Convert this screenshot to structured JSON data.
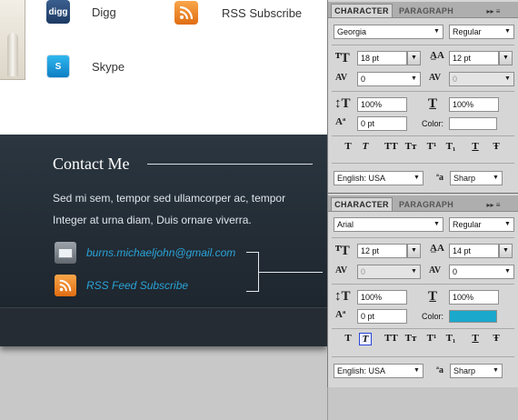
{
  "social": {
    "digg": {
      "icon": "digg-icon",
      "label": "Digg"
    },
    "rss": {
      "icon": "rss-icon",
      "label": "RSS Subscribe"
    },
    "skype": {
      "icon": "skype-icon",
      "label": "Skype"
    }
  },
  "footer": {
    "title": "Contact Me",
    "line1": "Sed mi sem, tempor sed ullamcorper ac, tempor",
    "line2": "Integer at urna diam, Duis ornare viverra.",
    "email": "burns.michaeljohn@gmail.com",
    "rss_link": "RSS Feed Subscribe"
  },
  "panel1": {
    "tabs": [
      "CHARACTER",
      "PARAGRAPH"
    ],
    "menu": "▸▸ ≡",
    "font_family": "Georgia",
    "font_style": "Regular",
    "font_size": "18 pt",
    "leading": "12 pt",
    "kerning": "0",
    "tracking": "0",
    "vscale": "100%",
    "hscale": "100%",
    "baseline": "0 pt",
    "color_label": "Color:",
    "color": "#ffffff",
    "language": "English: USA",
    "aa_label": "ªa",
    "antialias": "Sharp"
  },
  "panel2": {
    "tabs": [
      "CHARACTER",
      "PARAGRAPH"
    ],
    "menu": "▸▸ ≡",
    "font_family": "Arial",
    "font_style": "Regular",
    "font_size": "12 pt",
    "leading": "14 pt",
    "kerning": "0",
    "tracking": "0",
    "vscale": "100%",
    "hscale": "100%",
    "baseline": "0 pt",
    "color_label": "Color:",
    "color": "#1aa8cc",
    "language": "English: USA",
    "aa_label": "ªa",
    "antialias": "Sharp"
  },
  "type_buttons": [
    "T",
    "T",
    "TT",
    "Tт",
    "T¹",
    "T₁",
    "T",
    "Ŧ"
  ]
}
